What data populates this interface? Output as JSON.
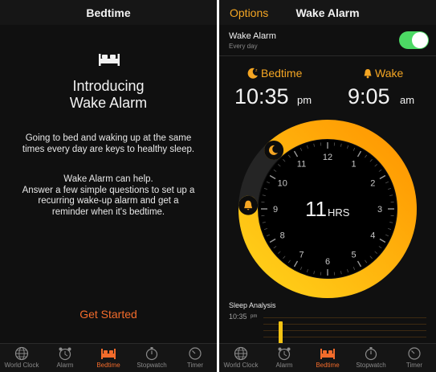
{
  "left_screen": {
    "nav_title": "Bedtime",
    "icon": "bed-icon",
    "intro_title_line1": "Introducing",
    "intro_title_line2": "Wake Alarm",
    "paragraph1": "Going to bed and waking up at the same times every day are keys to healthy sleep.",
    "paragraph2_line1": "Wake Alarm can help.",
    "paragraph2_line2": "Answer a few simple questions to set up a recurring wake-up alarm and get a reminder when it's bedtime.",
    "get_started": "Get Started"
  },
  "right_screen": {
    "nav_left": "Options",
    "nav_title": "Wake Alarm",
    "alarm_title": "Wake Alarm",
    "alarm_subtitle": "Every day",
    "alarm_enabled": true,
    "bedtime_label": "Bedtime",
    "bedtime_time": "10:35",
    "bedtime_ampm": "pm",
    "wake_label": "Wake",
    "wake_time": "9:05",
    "wake_ampm": "am",
    "duration_number": "11",
    "duration_unit": "HRS",
    "clock_numbers": [
      "12",
      "1",
      "2",
      "3",
      "4",
      "5",
      "6",
      "7",
      "8",
      "9",
      "10",
      "11"
    ],
    "sleep_analysis_title": "Sleep Analysis",
    "sleep_analysis_time": "10:35",
    "sleep_analysis_ampm": "pm"
  },
  "tabs": [
    {
      "label": "World Clock",
      "icon": "globe-icon"
    },
    {
      "label": "Alarm",
      "icon": "alarm-clock-icon"
    },
    {
      "label": "Bedtime",
      "icon": "bed-icon"
    },
    {
      "label": "Stopwatch",
      "icon": "stopwatch-icon"
    },
    {
      "label": "Timer",
      "icon": "timer-icon"
    }
  ],
  "active_tab": "Bedtime",
  "colors": {
    "accent_orange": "#f5a623",
    "tab_active": "#f26b2b",
    "ring_start": "#ffd21a",
    "ring_end": "#ff9500",
    "toggle_on": "#4cd964"
  }
}
